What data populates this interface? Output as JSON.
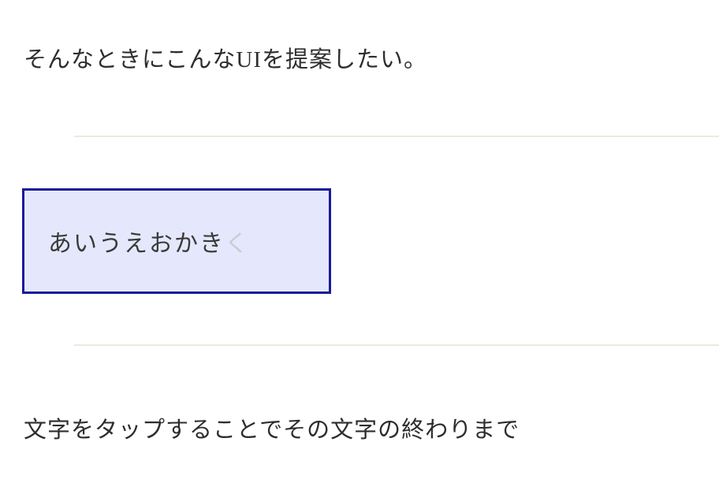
{
  "paragraphs": {
    "top": "そんなときにこんなUIを提案したい。",
    "bottom": "文字をタップすることでその文字の終わりまで"
  },
  "demo": {
    "visible_text": "あいうえおかき",
    "faded_text": "く"
  }
}
